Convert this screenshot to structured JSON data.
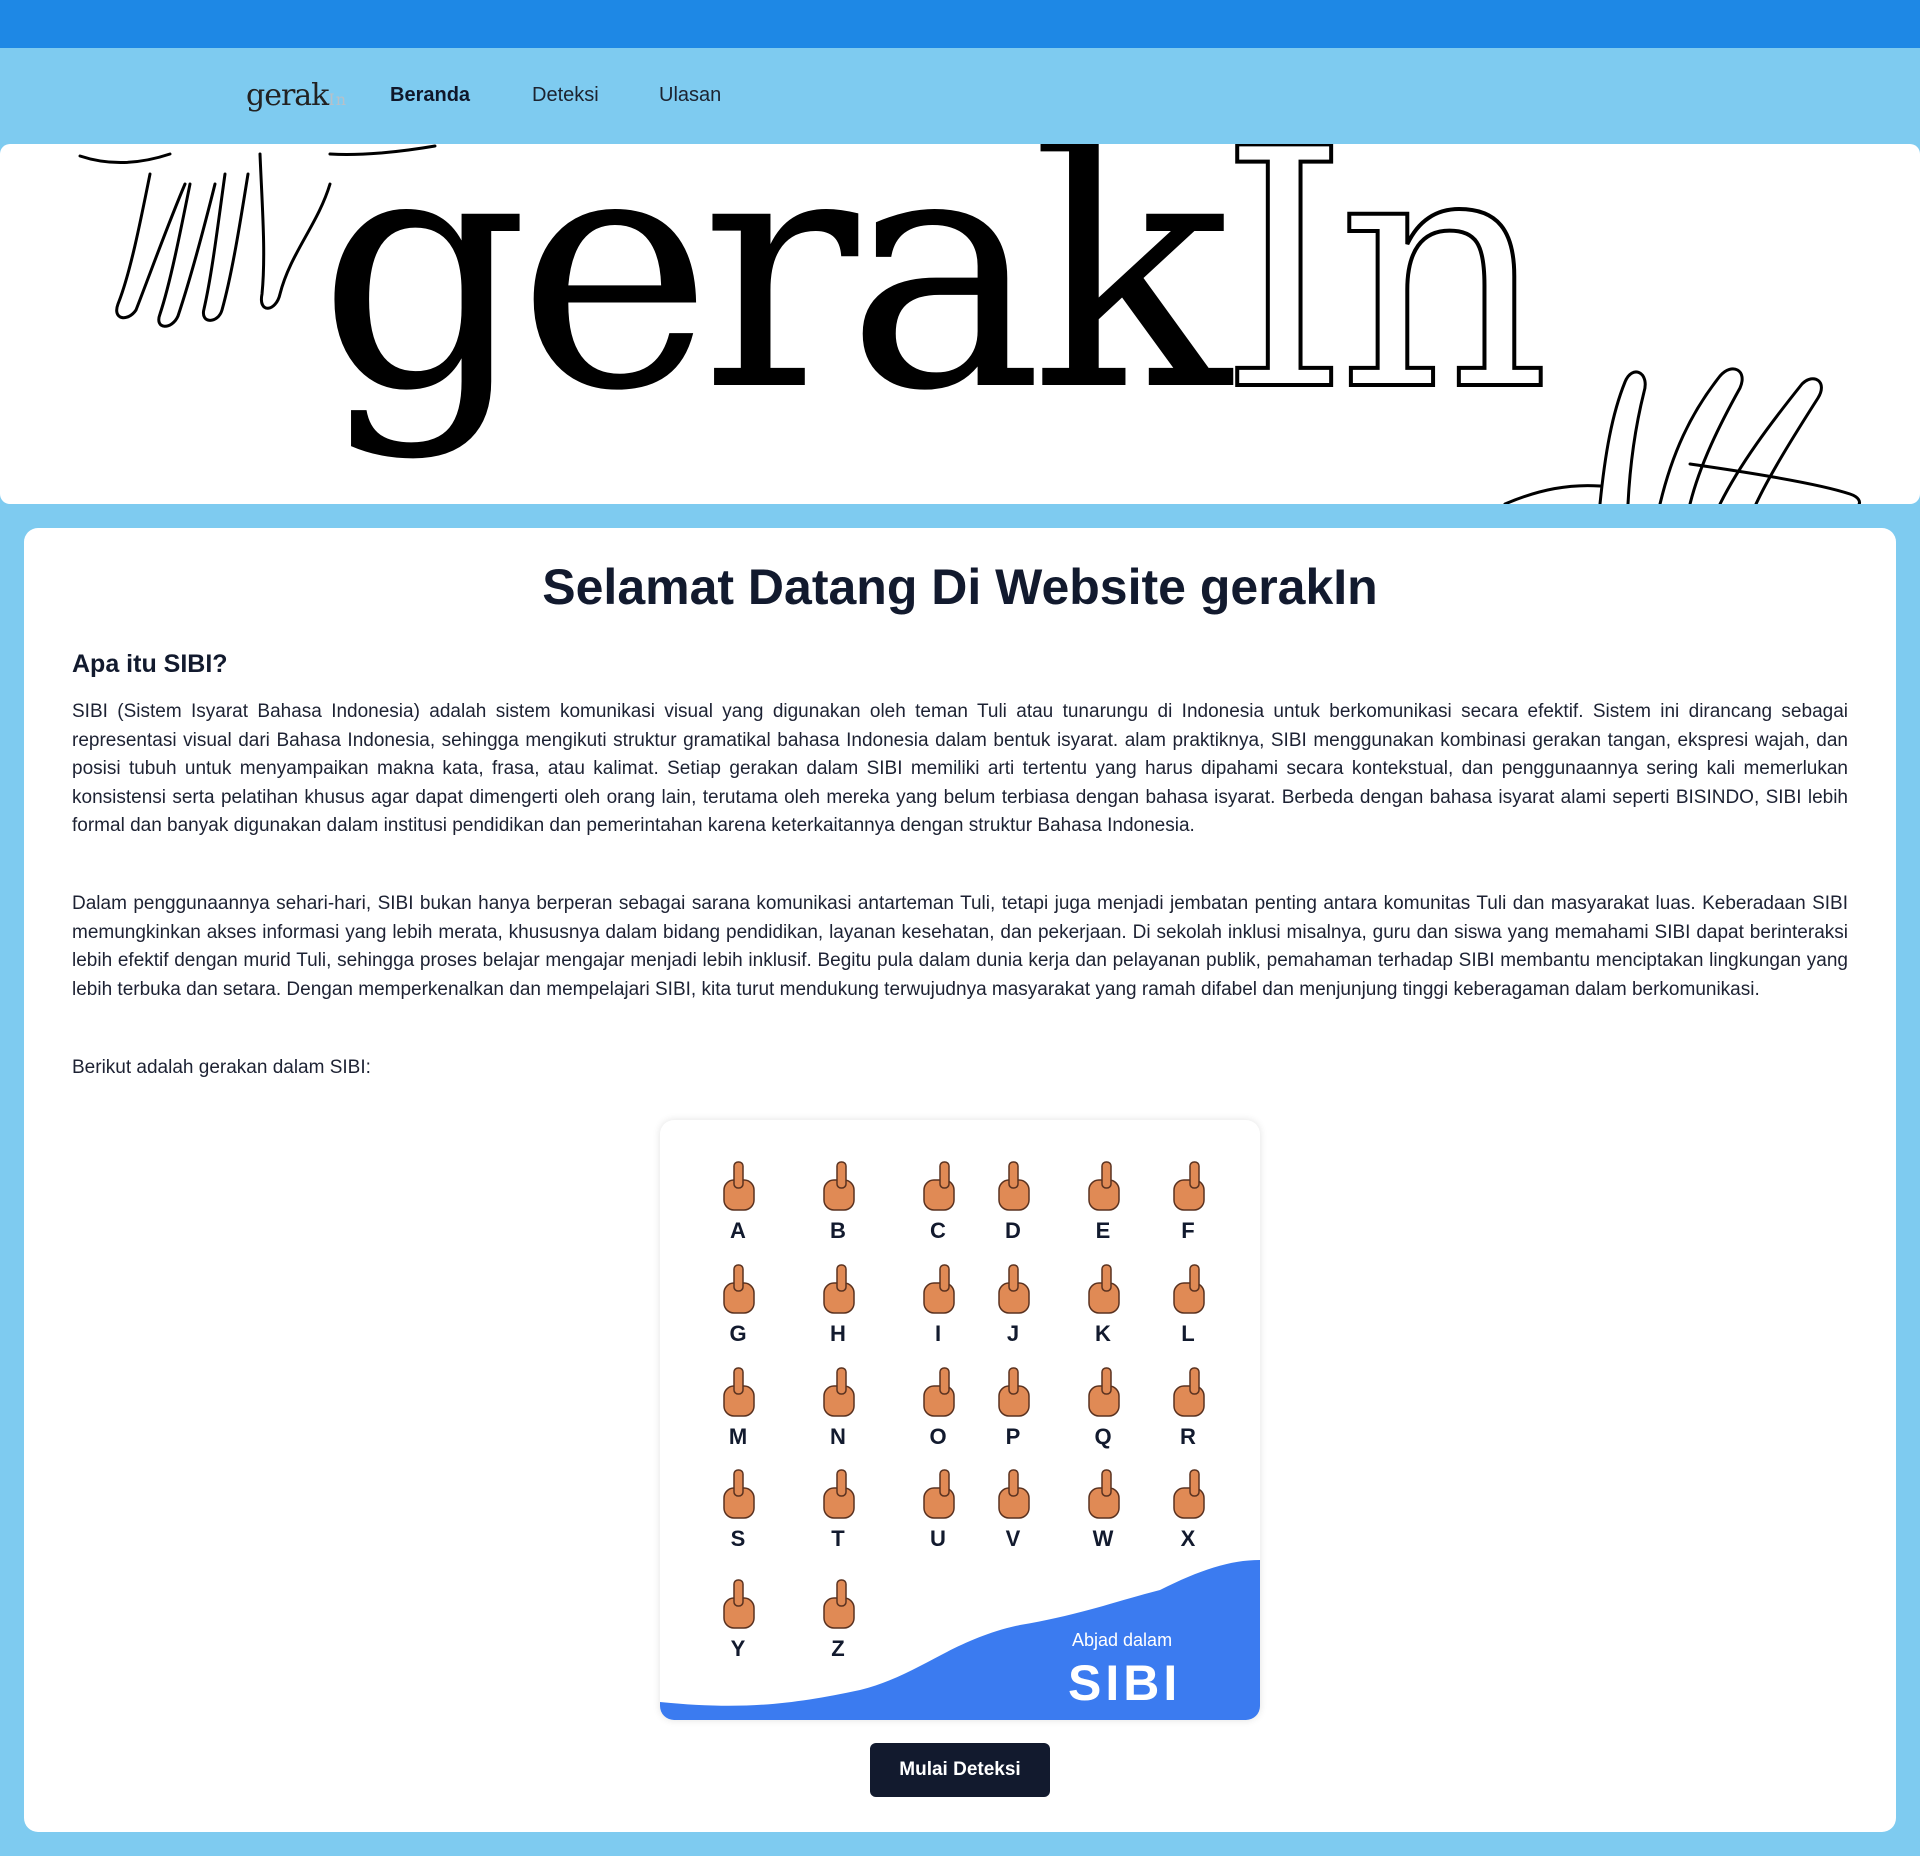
{
  "nav": {
    "logo_main": "gerak",
    "logo_faded": "In",
    "links": [
      "Beranda",
      "Deteksi",
      "Ulasan"
    ],
    "active": "Beranda"
  },
  "hero": {
    "word_solid": "gerak",
    "word_outline": "In"
  },
  "main": {
    "title": "Selamat Datang Di Website gerakIn",
    "section_heading": "Apa itu SIBI?",
    "paragraphs": [
      "SIBI (Sistem Isyarat Bahasa Indonesia) adalah sistem komunikasi visual yang digunakan oleh teman Tuli atau tunarungu di Indonesia untuk berkomunikasi secara efektif. Sistem ini dirancang sebagai representasi visual dari Bahasa Indonesia, sehingga mengikuti struktur gramatikal bahasa Indonesia dalam bentuk isyarat. alam praktiknya, SIBI menggunakan kombinasi gerakan tangan, ekspresi wajah, dan posisi tubuh untuk menyampaikan makna kata, frasa, atau kalimat. Setiap gerakan dalam SIBI memiliki arti tertentu yang harus dipahami secara kontekstual, dan penggunaannya sering kali memerlukan konsistensi serta pelatihan khusus agar dapat dimengerti oleh orang lain, terutama oleh mereka yang belum terbiasa dengan bahasa isyarat. Berbeda dengan bahasa isyarat alami seperti BISINDO, SIBI lebih formal dan banyak digunakan dalam institusi pendidikan dan pemerintahan karena keterkaitannya dengan struktur Bahasa Indonesia.",
      "Dalam penggunaannya sehari-hari, SIBI bukan hanya berperan sebagai sarana komunikasi antarteman Tuli, tetapi juga menjadi jembatan penting antara komunitas Tuli dan masyarakat luas. Keberadaan SIBI memungkinkan akses informasi yang lebih merata, khususnya dalam bidang pendidikan, layanan kesehatan, dan pekerjaan. Di sekolah inklusi misalnya, guru dan siswa yang memahami SIBI dapat berinteraksi lebih efektif dengan murid Tuli, sehingga proses belajar mengajar menjadi lebih inklusif. Begitu pula dalam dunia kerja dan pelayanan publik, pemahaman terhadap SIBI membantu menciptakan lingkungan yang lebih terbuka dan setara. Dengan memperkenalkan dan mempelajari SIBI, kita turut mendukung terwujudnya masyarakat yang ramah difabel dan menjunjung tinggi keberagaman dalam berkomunikasi.",
      "Berikut adalah gerakan dalam SIBI:"
    ],
    "cta_label": "Mulai Deteksi"
  },
  "sibi_image": {
    "letters": [
      "A",
      "B",
      "C",
      "D",
      "E",
      "F",
      "G",
      "H",
      "I",
      "J",
      "K",
      "L",
      "M",
      "N",
      "O",
      "P",
      "Q",
      "R",
      "S",
      "T",
      "U",
      "V",
      "W",
      "X",
      "Y",
      "Z"
    ],
    "caption_small": "Abjad dalam",
    "caption_big": "SIBI"
  },
  "colors": {
    "page_bg": "#7ecbf0",
    "top_strip": "#1e88e5",
    "accent_blue": "#3b7bf0",
    "skin": "#e08a55",
    "dark": "#121a2e"
  }
}
